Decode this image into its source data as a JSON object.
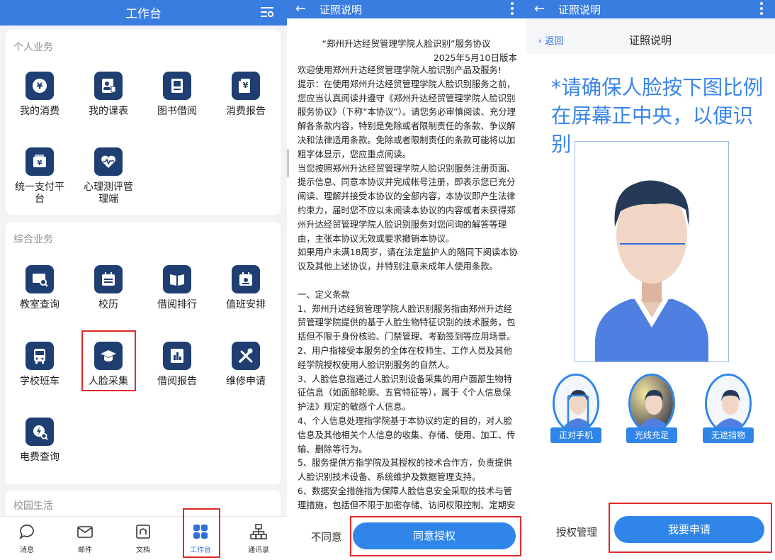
{
  "workbench": {
    "title": "工作台",
    "personal": {
      "title": "个人业务",
      "items": [
        {
          "label": "我的消费",
          "icon": "wallet-yen-icon"
        },
        {
          "label": "我的课表",
          "icon": "schedule-icon"
        },
        {
          "label": "图书借阅",
          "icon": "book-icon"
        },
        {
          "label": "消费报告",
          "icon": "report-yen-icon"
        },
        {
          "label": "统一支付平台",
          "icon": "payment-card-icon"
        },
        {
          "label": "心理测评管理端",
          "icon": "heart-pulse-icon"
        }
      ]
    },
    "general": {
      "title": "综合业务",
      "items": [
        {
          "label": "教室查询",
          "icon": "classroom-search-icon"
        },
        {
          "label": "校历",
          "icon": "calendar-icon"
        },
        {
          "label": "借阅排行",
          "icon": "open-book-icon"
        },
        {
          "label": "值班安排",
          "icon": "duty-calendar-icon"
        },
        {
          "label": "学校班车",
          "icon": "bus-icon"
        },
        {
          "label": "人脸采集",
          "icon": "graduation-cap-icon"
        },
        {
          "label": "借阅报告",
          "icon": "bar-report-icon"
        },
        {
          "label": "维修申请",
          "icon": "tools-icon"
        },
        {
          "label": "电费查询",
          "icon": "electric-search-icon"
        }
      ]
    },
    "campus": {
      "title": "校园生活"
    },
    "tabs": [
      {
        "label": "消息",
        "icon": "chat-icon"
      },
      {
        "label": "邮件",
        "icon": "mail-icon"
      },
      {
        "label": "文档",
        "icon": "document-icon"
      },
      {
        "label": "工作台",
        "icon": "grid-icon"
      },
      {
        "label": "通讯录",
        "icon": "org-chart-icon"
      }
    ]
  },
  "agreement": {
    "bar_title": "证照说明",
    "title": "“郑州升达经贸管理学院人脸识别”服务协议",
    "date": "2025年5月10日版本",
    "paragraphs": [
      "欢迎使用郑州升达经贸管理学院人脸识别产品及服务!",
      "提示：在使用郑州升达经贸管理学院人脸识别服务之前，您应当认真阅读并遵守《郑州升达经贸管理学院人脸识别服务协议》（下称“本协议”）。请您务必审慎阅读、充分理解各条款内容，特别是免除或者限制责任的条款、争议解决和法律适用条款。免除或者限制责任的条款可能将以加粗字体显示，您应重点阅读。",
      "当您按照郑州升达经贸管理学院人脸识别服务注册页面、提示信息、同意本协议并完成帐号注册，即表示您已充分阅读、理解并接受本协议的全部内容，本协议即产生法律约束力，届时您不应以未阅读本协议的内容或者未获得郑州升达经贸管理学院人脸识别服务对您问询的解答等理由，主张本协议无效或要求撤销本协议。",
      "如果用户未满18周岁，请在法定监护人的陪同下阅读本协议及其他上述协议，并特别注意未成年人使用条款。",
      "",
      "一、定义条款",
      "1、郑州升达经贸管理学院人脸识别服务指由郑州升达经贸管理学院提供的基于人脸生物特征识别的技术服务，包括但不限于身份核验、门禁管理、考勤签到等应用场景。",
      "2、用户指接受本服务的全体在校师生、工作人员及其他经学院授权使用人脸识别服务的自然人。",
      "3、人脸信息指通过人脸识别设备采集的用户面部生物特征信息（如面部轮廓、五官特征等），属于《个人信息保护法》规定的敏感个人信息。",
      "4、个人信息处理指学院基于本协议约定的目的，对人脸信息及其他相关个人信息的收集、存储、使用、加工、传输、删除等行为。",
      "5、服务提供方指学院及其授权的技术合作方，负责提供人脸识别技术设备、系统维护及数据管理支持。",
      "6、数据安全措施指为保障人脸信息安全采取的技术与管理措施，包括但不限于加密存储、访问权限控制、定期安全"
    ],
    "disagree": "不同意",
    "agree": "同意授权"
  },
  "guide": {
    "bar_title": "证照说明",
    "back": "返回",
    "subtitle": "证照说明",
    "notice_line1": "*请确保人脸按下图比例",
    "notice_line2": "在屏幕正中央，以便识别",
    "rules": [
      {
        "label": "正对手机"
      },
      {
        "label": "光线充足"
      },
      {
        "label": "无遮挡物"
      }
    ],
    "auth": "授权管理",
    "apply": "我要申请"
  },
  "colors": {
    "primary": "#3a7de0",
    "button": "#2f86e8",
    "tile": "#1f3f73",
    "highlight": "#e02a2a"
  }
}
